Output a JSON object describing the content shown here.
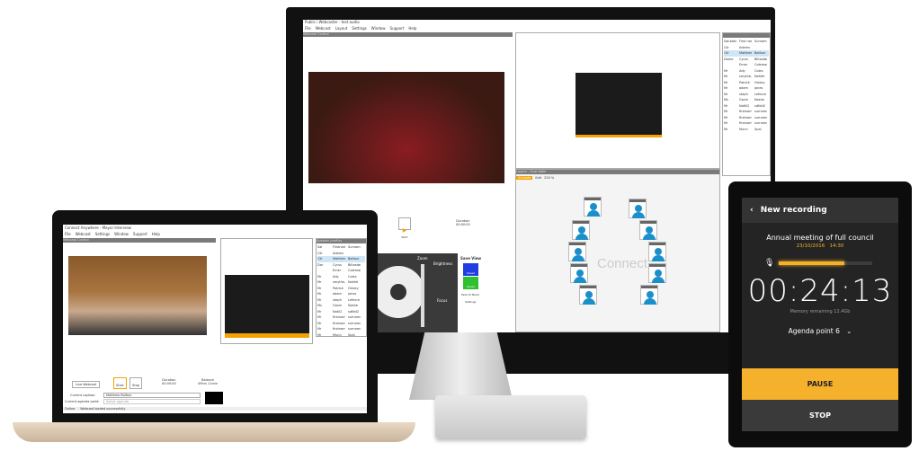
{
  "desktop": {
    "title": "Public i Webcaster - test audio",
    "menu": [
      "File",
      "Webcast",
      "Layout",
      "Settings",
      "Window",
      "Support",
      "Help"
    ],
    "webcast_panel": "Webcast Control",
    "start_label": "Start",
    "duration_label": "Duration",
    "duration_value": "00:00:00",
    "layout_panel": "Layout - Oval table",
    "layout_toolbar": {
      "activate": "Activate",
      "edit": "Edit",
      "zoom": "200 %"
    },
    "watermark": "Connect",
    "camera": {
      "title": "ols",
      "zoom": "Zoom",
      "brightness": "Brightness",
      "focus": "Focus",
      "save_view": "Save View",
      "saved1": "Saved",
      "saved2": "Saved",
      "fade": "Fade To Black",
      "settings": "Settings"
    },
    "speakers": {
      "headers": [
        "Salutation",
        "First name",
        "Surname"
      ],
      "rows": [
        [
          "Cllr",
          "Adams",
          ""
        ],
        [
          "Cllr",
          "Matthew",
          "Balfour"
        ],
        [
          "Dame",
          "Cyrus",
          "Blitzadel"
        ],
        [
          "",
          "Emer",
          "Coleman"
        ],
        [
          "Mr",
          "Ady",
          "Coles"
        ],
        [
          "Mr",
          "smythe-ole",
          "Nahfel"
        ],
        [
          "Mr",
          "Patrick",
          "Hickey"
        ],
        [
          "Mr",
          "adam",
          "jones"
        ],
        [
          "Mr",
          "steph",
          "Lefevre"
        ],
        [
          "Ms",
          "Gavin",
          "Noshe"
        ],
        [
          "Mr",
          "Natlil2",
          "sdfdd2"
        ],
        [
          "Mr",
          "firstname",
          "surname"
        ],
        [
          "Mr",
          "firstname",
          "surname"
        ],
        [
          "Mr",
          "firstname",
          "surname"
        ],
        [
          "Mr",
          "Munn",
          "Spal"
        ]
      ]
    }
  },
  "laptop": {
    "title": "Connect Anywhere - Mayor Interview",
    "menu": [
      "File",
      "Webcast",
      "Settings",
      "Window",
      "Support",
      "Help"
    ],
    "webcast_panel": "Webcast Control",
    "speaker_panel": "Speaker profiles",
    "live_label": "Live Webcast",
    "start_label": "Start",
    "stop_label": "Stop",
    "duration_label": "Duration",
    "duration_value": "00:00:00",
    "balance_label": "Balance",
    "balance_value": "49hrs 11min",
    "caption_label": "Current caption:",
    "caption_value": "Matthew Balfour",
    "agenda_label": "Current agenda point:",
    "agenda_placeholder": "Select agenda",
    "status_online": "Online",
    "status_msg": "Webcast loaded successfully",
    "speakers": {
      "headers": [
        "Sal",
        "Firstname",
        "Surname"
      ],
      "rows": [
        [
          "Cllr",
          "Adams",
          ""
        ],
        [
          "Cllr",
          "Matthew",
          "Balfour"
        ],
        [
          "Dar",
          "Cyrus",
          "Blitzadel"
        ],
        [
          "",
          "Emer",
          "Coleman"
        ],
        [
          "Mr",
          "Ady",
          "Coles"
        ],
        [
          "Mr",
          "smythe-s",
          "Nahfel"
        ],
        [
          "Mr",
          "Patrick",
          "Hickey"
        ],
        [
          "Mr",
          "adam",
          "jones"
        ],
        [
          "Mr",
          "steph",
          "Lefevre"
        ],
        [
          "Ms",
          "Gavin",
          "Noshe"
        ],
        [
          "Mr",
          "Natli2",
          "sdfdd2"
        ],
        [
          "Mr",
          "firstname",
          "surname"
        ],
        [
          "Mr",
          "firstname",
          "surname"
        ],
        [
          "Mr",
          "firstname",
          "surname"
        ],
        [
          "Mr",
          "Munn",
          "Spal"
        ]
      ]
    }
  },
  "tablet": {
    "header": "New recording",
    "meeting": "Annual meeting of full council",
    "date": "23/10/2016",
    "time": "14:30",
    "audio_level": 0.7,
    "timer": "00:24:13",
    "memory": "Memory remaining 12.4Gb",
    "agenda": "Agenda point 6",
    "pause": "PAUSE",
    "stop": "STOP",
    "accent": "#f5b12b"
  }
}
